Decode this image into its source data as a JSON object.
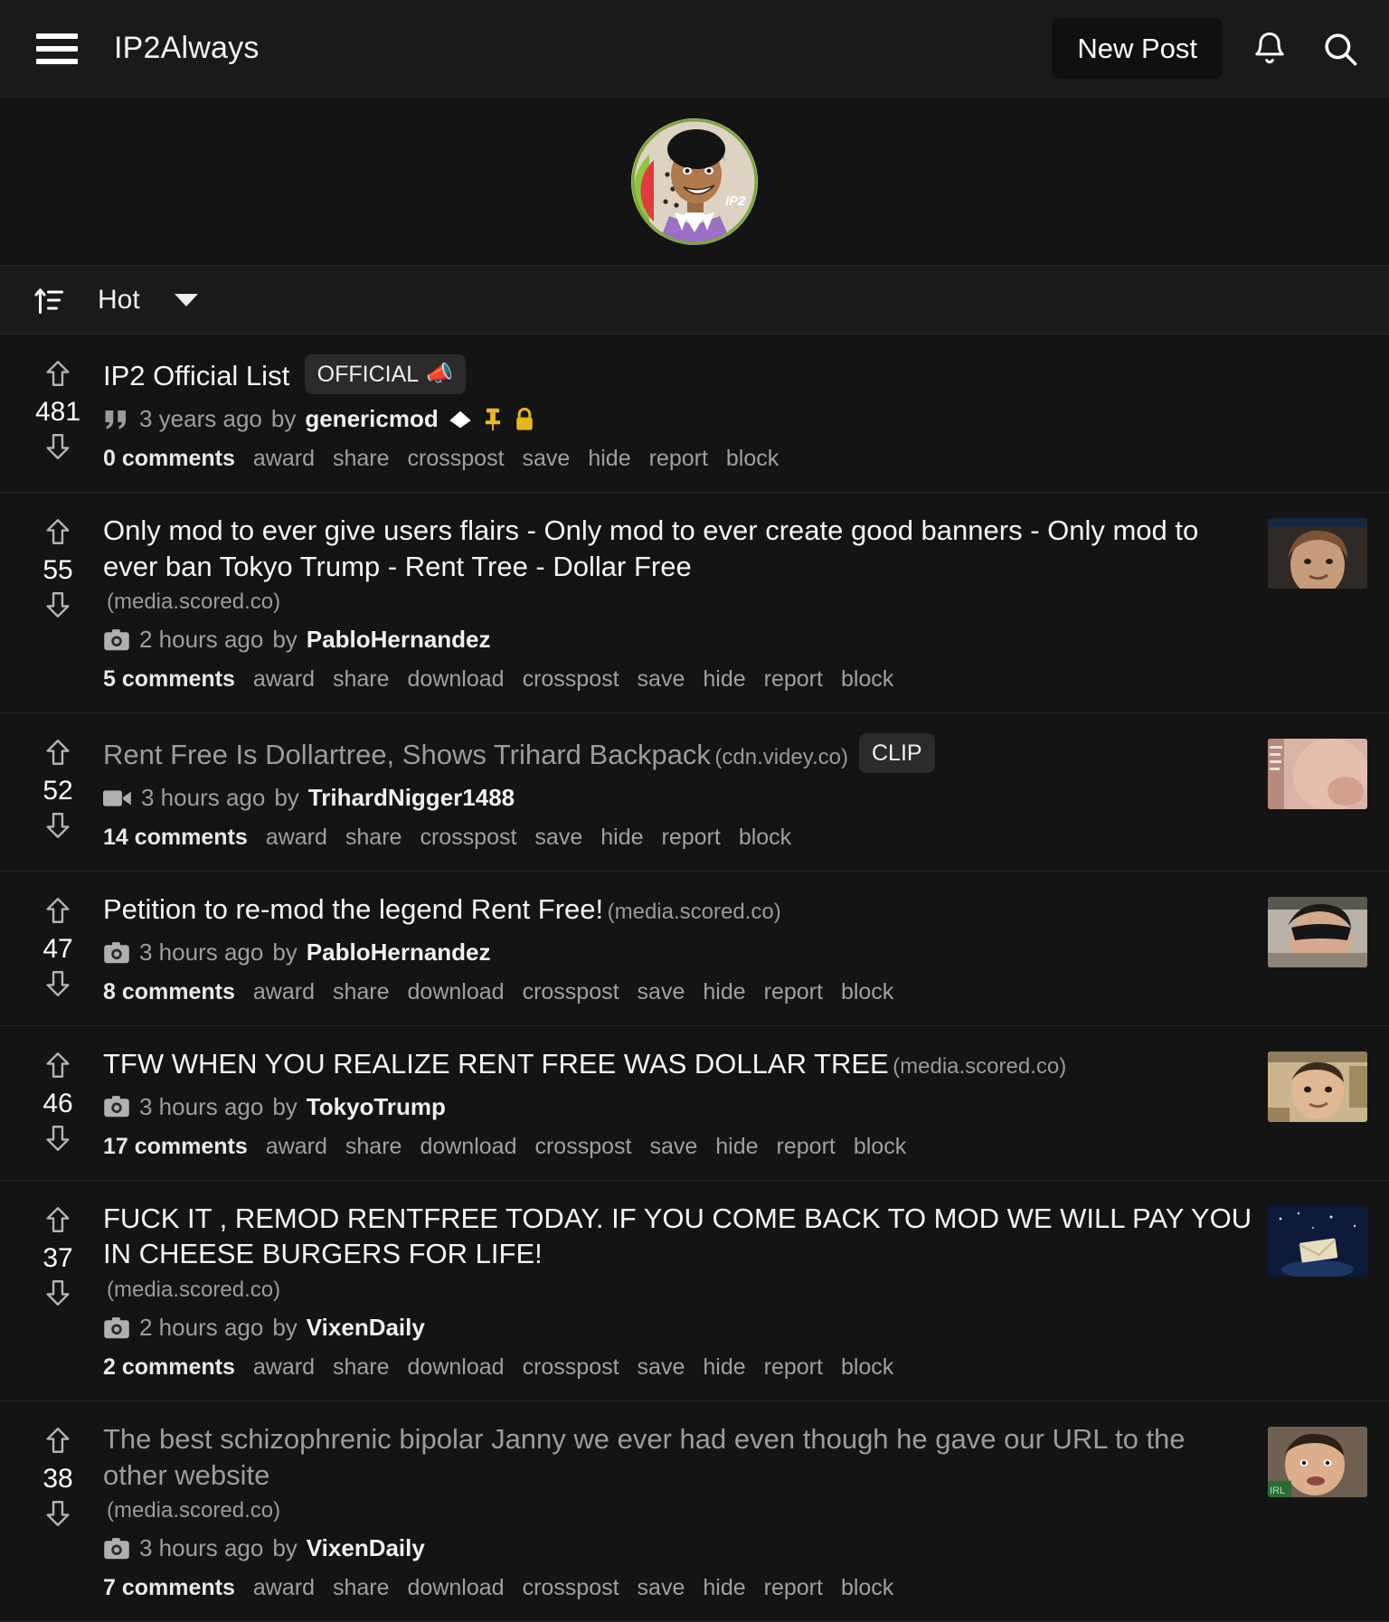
{
  "header": {
    "menu_icon": "hamburger-menu-icon",
    "brand": "IP2Always",
    "new_post_label": "New Post",
    "notifications_icon": "bell-icon",
    "search_icon": "search-icon"
  },
  "banner": {
    "avatar_icon": "community-avatar"
  },
  "sortbar": {
    "sort_icon": "sort-icon",
    "label": "Hot",
    "caret_icon": "chevron-down-icon"
  },
  "colors": {
    "background": "#141414",
    "header_bg": "#1a1a1a",
    "text": "#f5f5f5",
    "muted": "#9e9e9e",
    "badge_bg": "#2b2b2b",
    "pin_yellow": "#f0b429",
    "lock_yellow": "#e8b61a",
    "divider": "#262626"
  },
  "posts": [
    {
      "score": "481",
      "title": "IP2 Official List",
      "visited": false,
      "badge": {
        "label": "OFFICIAL",
        "emoji": "📣"
      },
      "domain": "",
      "domain_block": false,
      "meta_icon": "quote-icon",
      "time": "3 years ago",
      "by": "by",
      "author": "genericmod",
      "flags": [
        "mod-diamond-icon",
        "pin-icon",
        "lock-icon"
      ],
      "comments": "0 comments",
      "actions": [
        "award",
        "share",
        "crosspost",
        "save",
        "hide",
        "report",
        "block"
      ],
      "thumbnail": null
    },
    {
      "score": "55",
      "title": "Only mod to ever give users flairs - Only mod to ever create good banners - Only mod to ever ban Tokyo Trump - Rent Tree - Dollar Free",
      "visited": false,
      "badge": null,
      "domain": "(media.scored.co)",
      "domain_block": true,
      "meta_icon": "camera-icon",
      "time": "2 hours ago",
      "by": "by",
      "author": "PabloHernandez",
      "flags": [],
      "comments": "5 comments",
      "actions": [
        "award",
        "share",
        "download",
        "crosspost",
        "save",
        "hide",
        "report",
        "block"
      ],
      "thumbnail": "person-face-thumbnail"
    },
    {
      "score": "52",
      "title": "Rent Free Is Dollartree, Shows Trihard Backpack",
      "visited": true,
      "badge": {
        "label": "CLIP",
        "emoji": ""
      },
      "domain": "(cdn.videy.co)",
      "domain_block": false,
      "meta_icon": "video-icon",
      "time": "3 hours ago",
      "by": "by",
      "author": "TrihardNigger1488",
      "flags": [],
      "comments": "14 comments",
      "actions": [
        "award",
        "share",
        "crosspost",
        "save",
        "hide",
        "report",
        "block"
      ],
      "thumbnail": "closeup-skin-thumbnail"
    },
    {
      "score": "47",
      "title": "Petition to re-mod the legend Rent Free!",
      "visited": false,
      "badge": null,
      "domain": "(media.scored.co)",
      "domain_block": false,
      "meta_icon": "camera-icon",
      "time": "3 hours ago",
      "by": "by",
      "author": "PabloHernandez",
      "flags": [],
      "comments": "8 comments",
      "actions": [
        "award",
        "share",
        "download",
        "crosspost",
        "save",
        "hide",
        "report",
        "block"
      ],
      "thumbnail": "sunglasses-person-thumbnail"
    },
    {
      "score": "46",
      "title": "TFW WHEN YOU REALIZE RENT FREE WAS DOLLAR TREE",
      "visited": false,
      "badge": null,
      "domain": "(media.scored.co)",
      "domain_block": false,
      "meta_icon": "camera-icon",
      "time": "3 hours ago",
      "by": "by",
      "author": "TokyoTrump",
      "flags": [],
      "comments": "17 comments",
      "actions": [
        "award",
        "share",
        "download",
        "crosspost",
        "save",
        "hide",
        "report",
        "block"
      ],
      "thumbnail": "man-indoor-thumbnail"
    },
    {
      "score": "37",
      "title": "FUCK IT , REMOD RENTFREE TODAY. IF YOU COME BACK TO MOD WE WILL PAY YOU IN CHEESE BURGERS FOR LIFE!",
      "visited": false,
      "badge": null,
      "domain": "(media.scored.co)",
      "domain_block": true,
      "meta_icon": "camera-icon",
      "time": "2 hours ago",
      "by": "by",
      "author": "VixenDaily",
      "flags": [],
      "comments": "2 comments",
      "actions": [
        "award",
        "share",
        "download",
        "crosspost",
        "save",
        "hide",
        "report",
        "block"
      ],
      "thumbnail": "night-sky-thumbnail"
    },
    {
      "score": "38",
      "title": "The best schizophrenic bipolar Janny we ever had even though he gave our URL to the other website",
      "visited": true,
      "badge": null,
      "domain": "(media.scored.co)",
      "domain_block": true,
      "meta_icon": "camera-icon",
      "time": "3 hours ago",
      "by": "by",
      "author": "VixenDaily",
      "flags": [],
      "comments": "7 comments",
      "actions": [
        "award",
        "share",
        "download",
        "crosspost",
        "save",
        "hide",
        "report",
        "block"
      ],
      "thumbnail": "man-webcam-thumbnail"
    }
  ]
}
